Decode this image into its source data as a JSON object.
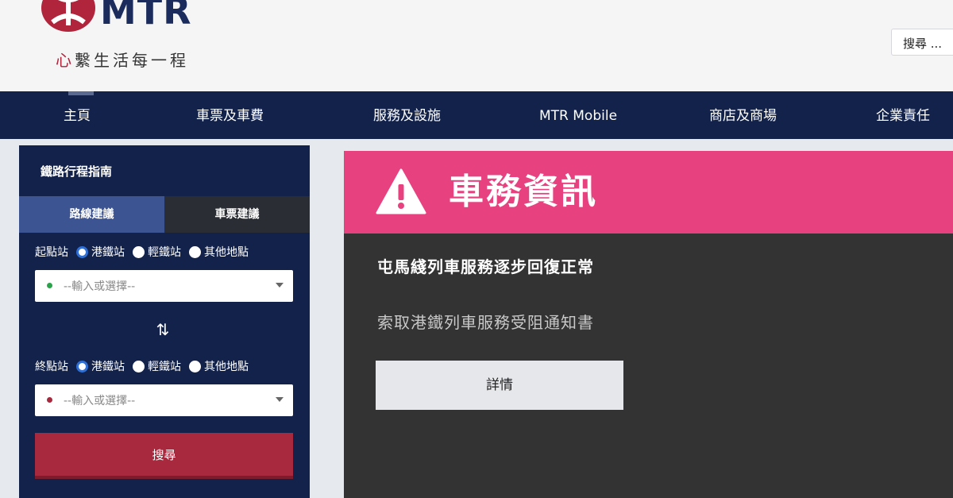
{
  "header": {
    "logo_text": "MTR",
    "slogan_heart": "心",
    "slogan_rest": "繫生活每一程",
    "search_label": "搜尋 ..."
  },
  "nav": {
    "items": [
      "主頁",
      "車票及車費",
      "服務及設施",
      "MTR Mobile",
      "商店及商場",
      "企業責任"
    ]
  },
  "planner": {
    "title": "鐵路行程指南",
    "tabs": [
      "路線建議",
      "車票建議"
    ],
    "origin_label": "起點站",
    "destination_label": "終點站",
    "station_types": [
      "港鐵站",
      "輕鐵站",
      "其他地點"
    ],
    "input_placeholder": "--輸入或選擇--",
    "swap_icon": "⇅",
    "search_button": "搜尋"
  },
  "service_info": {
    "title": "車務資訊",
    "headline": "屯馬綫列車服務逐步回復正常",
    "notice_link": "索取港鐵列車服務受阻通知書",
    "details_button": "詳情"
  },
  "colors": {
    "brand_navy": "#13224a",
    "alert_pink": "#e8417f",
    "search_red": "#a8283e",
    "tab_blue": "#3d5492"
  }
}
